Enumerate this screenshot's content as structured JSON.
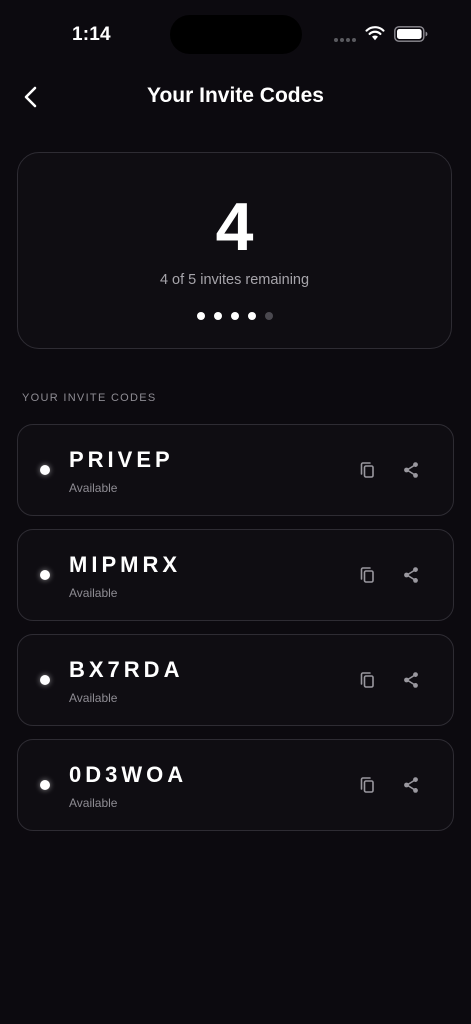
{
  "status_bar": {
    "time": "1:14",
    "wifi_icon": "wifi-icon",
    "battery_icon": "battery-icon"
  },
  "header": {
    "back_icon": "chevron-left-icon",
    "title": "Your Invite Codes"
  },
  "summary": {
    "remaining": "4",
    "remaining_text": "4 of 5 invites remaining",
    "used": 1,
    "total": 5
  },
  "section_label": "YOUR INVITE CODES",
  "codes": [
    {
      "code": "PRIVEP",
      "status": "Available"
    },
    {
      "code": "MIPMRX",
      "status": "Available"
    },
    {
      "code": "BX7RDA",
      "status": "Available"
    },
    {
      "code": "0D3WOA",
      "status": "Available"
    }
  ],
  "icons": {
    "copy": "copy-icon",
    "share": "share-icon"
  },
  "colors": {
    "background": "#0c0a0f",
    "card_border": "#2e2c33",
    "text_primary": "#ffffff",
    "text_secondary": "#8e8c93",
    "dot_active": "#ffffff",
    "dot_inactive": "#4a484f"
  }
}
